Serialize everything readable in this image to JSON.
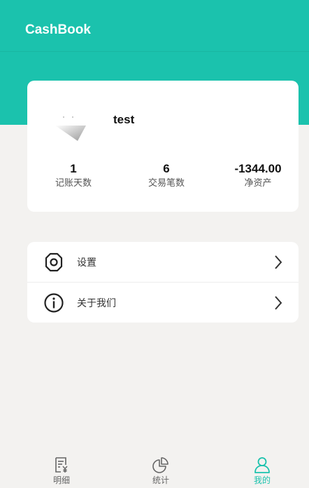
{
  "app": {
    "title": "CashBook"
  },
  "profile": {
    "username": "test",
    "stats": [
      {
        "value": "1",
        "label": "记账天数"
      },
      {
        "value": "6",
        "label": "交易笔数"
      },
      {
        "value": "-1344.00",
        "label": "净资产"
      }
    ]
  },
  "menu": {
    "items": [
      {
        "label": "设置",
        "icon": "gear-icon"
      },
      {
        "label": "关于我们",
        "icon": "info-icon"
      }
    ]
  },
  "bottom_nav": {
    "items": [
      {
        "label": "明细",
        "icon": "bill-icon",
        "active": false
      },
      {
        "label": "统计",
        "icon": "pie-chart-icon",
        "active": false
      },
      {
        "label": "我的",
        "icon": "person-icon",
        "active": true
      }
    ]
  },
  "colors": {
    "accent": "#1bc2ad",
    "inactive": "#666666"
  }
}
